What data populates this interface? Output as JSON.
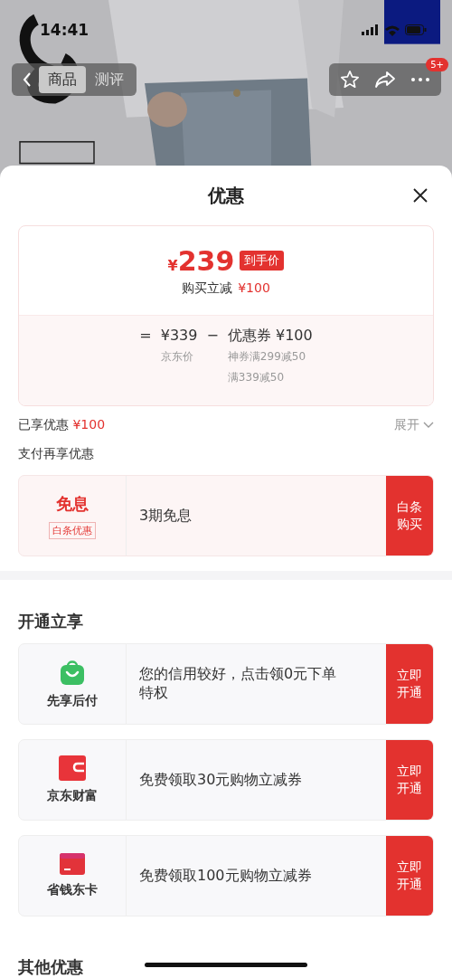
{
  "status_bar": {
    "time": "14:41"
  },
  "nav": {
    "tabs": [
      {
        "label": "商品",
        "selected": true
      },
      {
        "label": "测评",
        "selected": false
      }
    ],
    "badge": "5+"
  },
  "sheet": {
    "title": "优惠",
    "price": {
      "currency": "¥",
      "amount": "239",
      "tag": "到手价",
      "subtitle": "购买立减",
      "subtitle_amount": "¥100",
      "formula": {
        "equals": "=",
        "original": "¥339",
        "minus": "−",
        "coupon_label": "优惠券",
        "coupon_amount": "¥100",
        "original_label": "京东价",
        "coupon_notes": [
          "神券满299减50",
          "满339减50"
        ]
      }
    },
    "enjoyed": {
      "label": "已享优惠",
      "amount": "¥100",
      "expand": "展开"
    },
    "payment": {
      "title": "支付再享优惠",
      "offers": [
        {
          "title": "免息",
          "tag": "白条优惠",
          "text": "3期免息",
          "button": "白条购买"
        }
      ]
    },
    "open": {
      "title": "开通立享",
      "items": [
        {
          "kind": "bag",
          "name": "先享后付",
          "text": "您的信用较好，点击领0元下单特权",
          "button": "立即开通"
        },
        {
          "kind": "wallet",
          "name": "京东财富",
          "text": "免费领取30元购物立减券",
          "button": "立即开通"
        },
        {
          "kind": "card",
          "name": "省钱东卡",
          "text": "免费领取100元购物立减券",
          "button": "立即开通"
        }
      ]
    },
    "others_title": "其他优惠"
  }
}
